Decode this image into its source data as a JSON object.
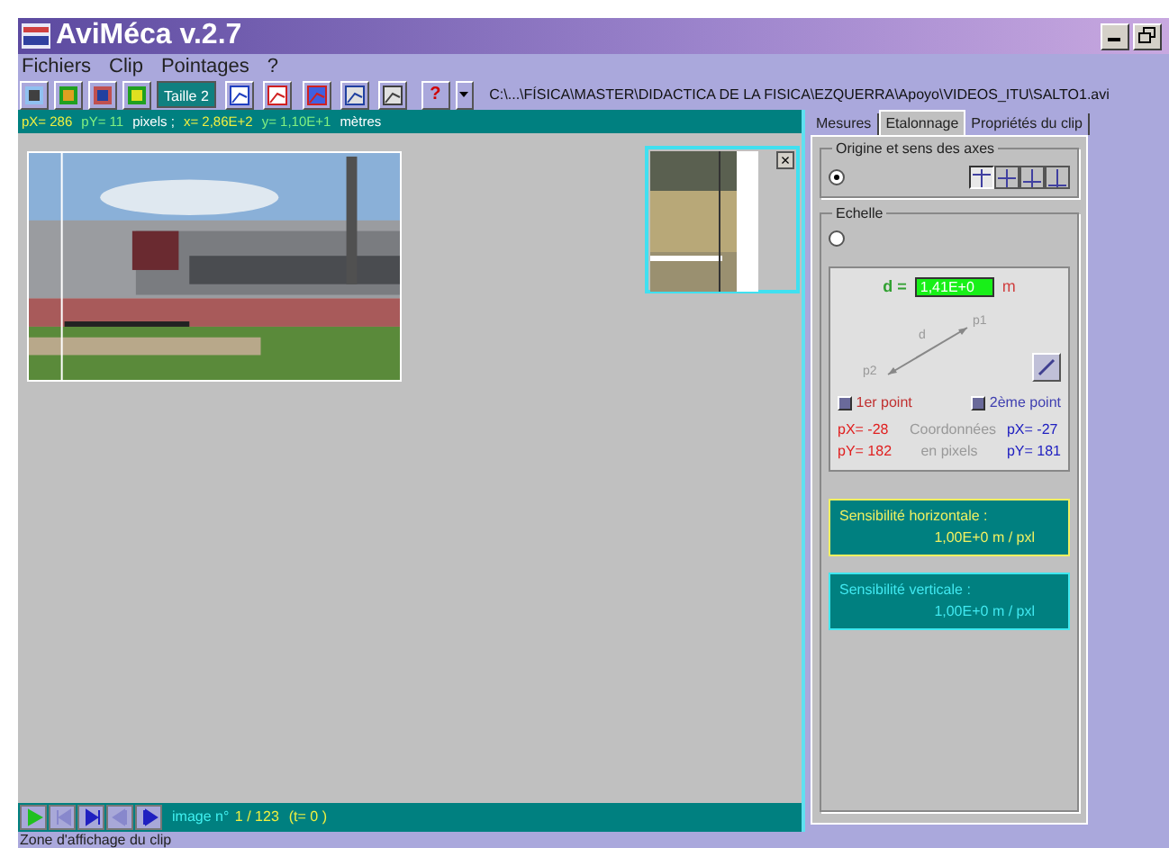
{
  "window": {
    "title": "AviMéca v.2.7"
  },
  "menu": [
    "Fichiers",
    "Clip",
    "Pointages",
    "?"
  ],
  "toolbar": {
    "size_label": "Taille 2",
    "help": "?",
    "path": "C:\\...\\FÍSICA\\MASTER\\DIDACTICA DE LA FISICA\\EZQUERRA\\Apoyo\\VIDEOS_ITU\\SALTO1.avi"
  },
  "readout": [
    {
      "text": "pX= 286",
      "kind": "x"
    },
    {
      "text": "pY= 11",
      "kind": "y"
    },
    {
      "text": "pixels ;",
      "kind": "unit"
    },
    {
      "text": "x= 2,86E+2",
      "kind": "x"
    },
    {
      "text": "y= 1,10E+1",
      "kind": "y"
    },
    {
      "text": "mètres",
      "kind": "unit"
    }
  ],
  "zoom_window": {
    "close": "×"
  },
  "playback": {
    "label": "image n°",
    "frame": "1 / 123",
    "time": "(t= 0 )"
  },
  "tabs": [
    {
      "label": "Mesures",
      "selected": false
    },
    {
      "label": "Etalonnage",
      "selected": true
    },
    {
      "label": "Propriétés du clip",
      "selected": false
    }
  ],
  "origin": {
    "title": "Origine et sens des axes",
    "radio_selected": true,
    "axes": [
      {
        "selected": true
      },
      {
        "selected": false
      },
      {
        "selected": false
      },
      {
        "selected": false
      }
    ]
  },
  "scale": {
    "title": "Echelle",
    "radio_selected": false,
    "d_label": "d =",
    "d_value": "1,41E+0",
    "unit": "m",
    "p1": "p1",
    "p2": "p2",
    "d": "d",
    "point1": {
      "label": "1er point",
      "checked": false,
      "px": "pX= -28",
      "py": "pY= 182"
    },
    "coords_label": "Coordonnées en pixels",
    "point2": {
      "label": "2ème point",
      "checked": false,
      "px": "pX= -27",
      "py": "pY= 181"
    }
  },
  "sensitivity": [
    {
      "title": "Sensibilité horizontale :",
      "value": "1,00E+0 m / pxl",
      "color": "#f0f060"
    },
    {
      "title": "Sensibilité verticale :",
      "value": "1,00E+0 m / pxl",
      "color": "#40e8f0"
    }
  ],
  "status_bar": "Zone d'affichage du clip"
}
